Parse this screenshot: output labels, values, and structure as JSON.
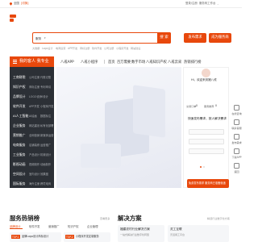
{
  "topbar": {
    "location": "全国",
    "switch": "[切换]",
    "links": [
      "登录/注册",
      "服务商工作台"
    ],
    "chevron": "⌄"
  },
  "search": {
    "category": "服务",
    "button": "搜 索",
    "hot_words": [
      "大数据",
      "Logo设计",
      "电商运营",
      "APP开发",
      "商标注册",
      "软件开发",
      "公司注册",
      "小程序开发",
      "网站建设"
    ]
  },
  "header_buttons": {
    "publish": "发布需求",
    "become_provider": "成为服务商"
  },
  "nav": {
    "category_label": "我的客人 我专业",
    "items": [
      "八戒APP",
      "八戒小程序",
      "首页",
      "百万需要",
      "数字市场",
      "八戒知识产权",
      "八戒云采",
      "热销排行榜"
    ]
  },
  "sidebar": {
    "rows": [
      {
        "head": "工商财税",
        "subs": [
          "公司注册",
          "代账记账"
        ]
      },
      {
        "head": "知识产权",
        "subs": [
          "商标注册",
          "专利申请"
        ]
      },
      {
        "head": "品牌设计",
        "subs": [
          "LOGO设计",
          "VI设计"
        ]
      },
      {
        "head": "软件开发",
        "subs": [
          "APP开发",
          "小程序开发"
        ]
      },
      {
        "head": "AI人工智能",
        "subs": [
          "AI绘画",
          "数据标注"
        ]
      },
      {
        "head": "企业服务",
        "subs": [
          "网站建设",
          "私有化部署"
        ]
      },
      {
        "head": "营销推广",
        "subs": [
          "全网营销",
          "新媒体运营"
        ]
      },
      {
        "head": "电商服务",
        "subs": [
          "店铺装修",
          "运营推广"
        ]
      },
      {
        "head": "工业服务",
        "subs": [
          "产品设计",
          "机械设计"
        ]
      },
      {
        "head": "影视动画",
        "subs": [
          "视频制作",
          "动画制作"
        ]
      },
      {
        "head": "空间设计",
        "subs": [
          "室内设计",
          "效果图"
        ]
      },
      {
        "head": "国际服务",
        "subs": [
          "海外注册",
          "跨境电商"
        ]
      }
    ]
  },
  "user_card": {
    "greeting": "Hi，欢迎来到猪八戒",
    "stats": [
      {
        "label": "交易订单",
        "value": "0"
      },
      {
        "label": "服务推荐",
        "value": "0"
      }
    ],
    "headline": "快速发布需求，按人解决需求",
    "demand_btn": "免费发布需求 服务商已准备就绪"
  },
  "float_bar": [
    {
      "icon": "chat-icon",
      "label": "在线咨询"
    },
    {
      "icon": "phone-icon",
      "label": "联系客服"
    },
    {
      "icon": "edit-icon",
      "label": "发布需求"
    },
    {
      "icon": "app-icon",
      "label": "下载APP"
    },
    {
      "icon": "up-icon",
      "label": "返回"
    }
  ],
  "hot_services": {
    "title": "服务热销榜",
    "more": "查看更多",
    "tabs": [
      "品牌设计",
      "软件开发",
      "营销推广",
      "知识产权",
      "企业管理"
    ],
    "cards": [
      {
        "badge": "TOP.1",
        "text": "品牌Logo设计商标设计"
      },
      {
        "badge": "TOP.2",
        "text": "小程序开发定制服务"
      }
    ]
  },
  "solutions": {
    "title": "解决方案",
    "more": "精选行业数字化方案",
    "cards": [
      {
        "title": "福建农村行业解决方案",
        "desc": "一站式解决行业数字化转型"
      },
      {
        "title": "灵工互联",
        "desc": "灵活用工平台"
      }
    ]
  },
  "colors": {
    "accent": "#e8480c",
    "sidebar_bg": "#2c3036"
  }
}
